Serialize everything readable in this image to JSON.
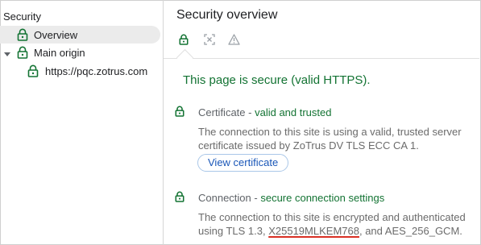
{
  "left_pane": {
    "root_label": "Security",
    "items": [
      {
        "label": "Overview"
      },
      {
        "label": "Main origin"
      },
      {
        "label": "https://pqc.zotrus.com"
      }
    ]
  },
  "main": {
    "title": "Security overview",
    "tabs": [
      {
        "icon": "lock-icon"
      },
      {
        "icon": "certificate-scan-icon"
      },
      {
        "icon": "warning-triangle-icon"
      }
    ],
    "summary": "This page is secure (valid HTTPS).",
    "certificate": {
      "label": "Certificate",
      "sep": " - ",
      "status": "valid and trusted",
      "description": "The connection to this site is using a valid, trusted server certificate issued by ZoTrus DV TLS ECC CA 1.",
      "button": "View certificate"
    },
    "connection": {
      "label": "Connection",
      "sep": " - ",
      "status": "secure connection settings",
      "desc_line1": "The connection to this site is encrypted and authenticated",
      "desc_prefix": "using TLS 1.3, ",
      "key_exchange": "X25519MLKEM768",
      "desc_suffix": ", and AES_256_GCM."
    }
  },
  "colors": {
    "secure_green": "#137333",
    "link_blue": "#1a57b8",
    "selected_bg": "#ebebeb",
    "highlight_red": "#d93025"
  }
}
